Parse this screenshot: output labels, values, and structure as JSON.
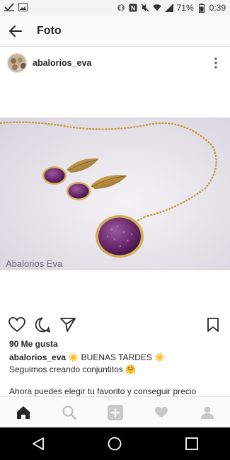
{
  "status_bar": {
    "battery_percent": "71%",
    "time": "0:39",
    "left_icons": [
      "check-icon",
      "image-icon"
    ],
    "right_icons": [
      "bluetooth-icon",
      "nfc-icon",
      "mute-icon",
      "wifi-icon",
      "signal-icon",
      "battery-icon"
    ]
  },
  "app_bar": {
    "title": "Foto"
  },
  "post": {
    "username": "abalorios_eva",
    "image_watermark": "Abalorios Eva",
    "likes": "90 Me gusta",
    "caption_user": "abalorios_eva",
    "caption_line1": " ☀️ BUENAS TARDES ☀️",
    "caption_line2": "Seguimos creando conjuntitos 🤗",
    "caption_line3": "Ahora puedes elegir tu favorito y conseguir precio"
  },
  "tab_bar": {
    "tabs": [
      "home-icon",
      "search-icon",
      "add-post-icon",
      "activity-icon",
      "profile-icon"
    ],
    "active": "home-icon"
  },
  "nav_bar": {
    "buttons": [
      "back-nav-icon",
      "home-nav-icon",
      "recents-nav-icon"
    ]
  },
  "colors": {
    "text": "#262626",
    "status_bg": "#f4f4f4",
    "app_bg": "#fafafa",
    "nav_bg": "#000000",
    "image_bg": "#e9e6ed",
    "druzy_purple": "#6a2a6e",
    "gold": "#c89a3c"
  }
}
